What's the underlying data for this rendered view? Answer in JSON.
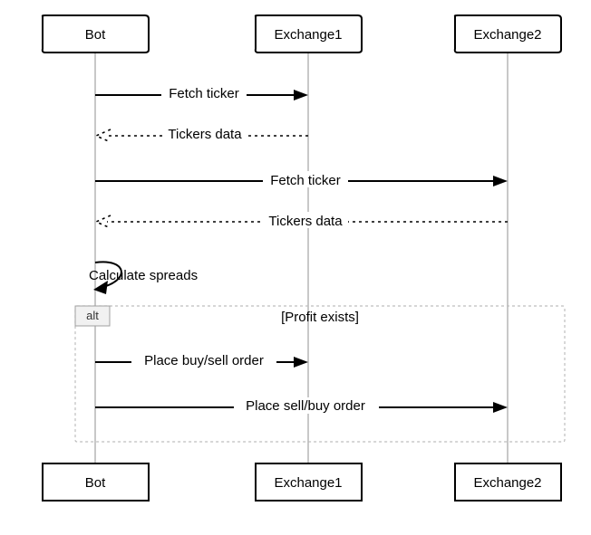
{
  "participants": {
    "bot": "Bot",
    "ex1": "Exchange1",
    "ex2": "Exchange2"
  },
  "messages": {
    "m1": "Fetch ticker",
    "m2": "Tickers data",
    "m3": "Fetch ticker",
    "m4": "Tickers data",
    "m5": "Calculate spreads",
    "m6": "Place buy/sell order",
    "m7": "Place sell/buy order"
  },
  "alt": {
    "tag": "alt",
    "condition": "[Profit exists]"
  }
}
